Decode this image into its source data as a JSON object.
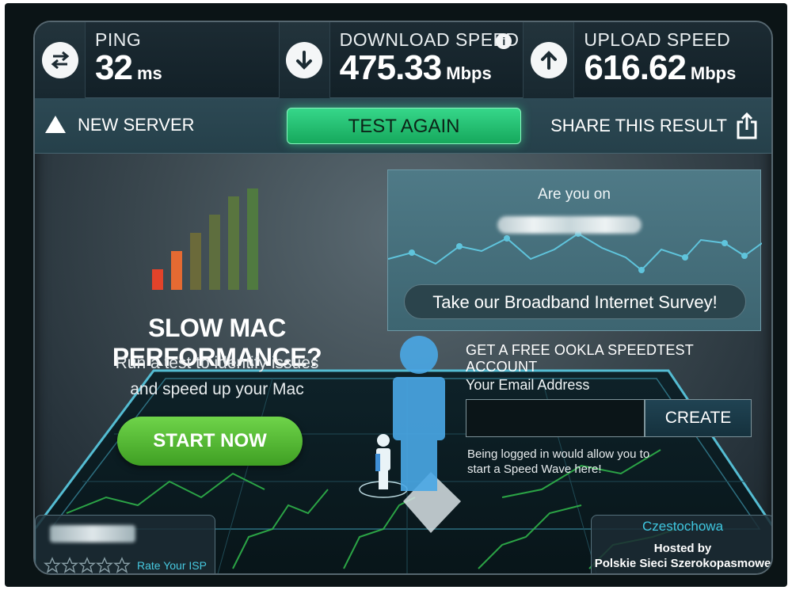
{
  "stats": {
    "ping": {
      "label": "PING",
      "value": "32",
      "unit": "ms"
    },
    "download": {
      "label": "DOWNLOAD SPEED",
      "value": "475.33",
      "unit": "Mbps",
      "info": "i"
    },
    "upload": {
      "label": "UPLOAD SPEED",
      "value": "616.62",
      "unit": "Mbps"
    }
  },
  "actions": {
    "new_server": "NEW SERVER",
    "test_again": "TEST AGAIN",
    "share": "SHARE THIS RESULT"
  },
  "promo": {
    "headline": "SLOW MAC PERFORMANCE?",
    "subline_1": "Run a test to identify issues",
    "subline_2": "and speed up your Mac",
    "start_now": "START NOW",
    "signal_bar_colors": [
      "#e2432a",
      "#e56a32",
      "#6b6a3a",
      "#5e6e3e",
      "#59753f",
      "#507a40"
    ]
  },
  "survey": {
    "question": "Are you on",
    "button": "Take our Broadband Internet Survey!"
  },
  "account": {
    "title": "GET A FREE OOKLA SPEEDTEST ACCOUNT",
    "email_label": "Your Email Address",
    "email_value": "",
    "create": "CREATE",
    "note_1": "Being logged in would allow you to",
    "note_2": "start a Speed Wave here!"
  },
  "isp": {
    "rate_label": "Rate Your ISP",
    "stars_filled": 0,
    "stars_total": 5
  },
  "host": {
    "city": "Czestochowa",
    "hosted_by": "Hosted by",
    "name": "Polskie Sieci Szerokopasmowe"
  },
  "colors": {
    "accent_green": "#2fcf7f",
    "accent_cyan": "#3fc7e0",
    "start_green": "#5bbf37"
  }
}
